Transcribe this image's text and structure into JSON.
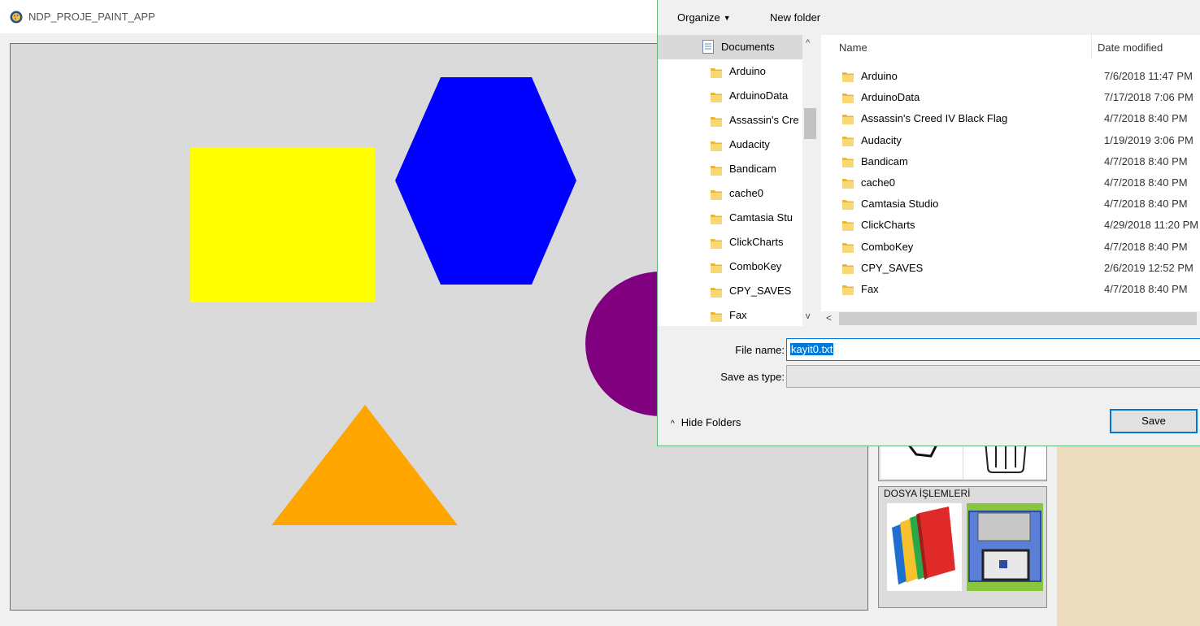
{
  "app": {
    "title": "NDP_PROJE_PAINT_APP",
    "file_group_title": "DOSYA İŞLEMLERİ"
  },
  "canvas": {
    "shapes": [
      {
        "kind": "rectangle",
        "color": "#ffff00"
      },
      {
        "kind": "hexagon",
        "color": "#0000ff"
      },
      {
        "kind": "circle",
        "color": "#800080"
      },
      {
        "kind": "triangle",
        "color": "#ffa500"
      }
    ]
  },
  "dialog": {
    "organize_label": "Organize",
    "new_folder_label": "New folder",
    "nav_root": "Documents",
    "nav_items": [
      "Arduino",
      "ArduinoData",
      "Assassin's Cre",
      "Audacity",
      "Bandicam",
      "cache0",
      "Camtasia Stu",
      "ClickCharts",
      "ComboKey",
      "CPY_SAVES",
      "Fax"
    ],
    "columns": {
      "name": "Name",
      "date": "Date modified"
    },
    "files": [
      {
        "name": "Arduino",
        "date": "7/6/2018 11:47 PM"
      },
      {
        "name": "ArduinoData",
        "date": "7/17/2018 7:06 PM"
      },
      {
        "name": "Assassin's Creed IV Black Flag",
        "date": "4/7/2018 8:40 PM"
      },
      {
        "name": "Audacity",
        "date": "1/19/2019 3:06 PM"
      },
      {
        "name": "Bandicam",
        "date": "4/7/2018 8:40 PM"
      },
      {
        "name": "cache0",
        "date": "4/7/2018 8:40 PM"
      },
      {
        "name": "Camtasia Studio",
        "date": "4/7/2018 8:40 PM"
      },
      {
        "name": "ClickCharts",
        "date": "4/29/2018 11:20 PM"
      },
      {
        "name": "ComboKey",
        "date": "4/7/2018 8:40 PM"
      },
      {
        "name": "CPY_SAVES",
        "date": "2/6/2019 12:52 PM"
      },
      {
        "name": "Fax",
        "date": "4/7/2018 8:40 PM"
      }
    ],
    "file_name_label": "File name:",
    "file_name_value": "kayit0.txt",
    "save_as_type_label": "Save as type:",
    "save_as_type_value": "",
    "hide_folders_label": "Hide Folders",
    "save_label": "Save"
  }
}
